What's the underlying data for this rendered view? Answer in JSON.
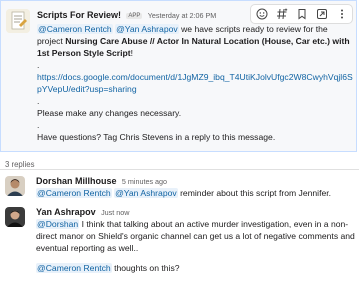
{
  "main_message": {
    "author": "Scripts For Review!",
    "badge": "APP",
    "timestamp": "Yesterday at 2:06 PM",
    "mention1": "@Cameron Rentch",
    "mention2": "@Yan Ashrapov",
    "text1": " we have scripts ready to review for the project ",
    "project": "Nursing Care Abuse // Actor In Natural Location (House, Car etc.) with 1st Person Style Script",
    "project_end": "!",
    "dot": ".",
    "link": "https://docs.google.com/document/d/1JgMZ9_ibq_T4UtiKJolvUfgc2W8CwyhVqjl6SpYVepU/edit?usp=sharing",
    "please": "Please make any changes necessary.",
    "questions": "Have questions? Tag Chris Stevens in a reply to this message.",
    "toolbar_icons": [
      "add-reaction-icon",
      "hashtag-icon",
      "bookmark-icon",
      "forward-icon",
      "more-icon"
    ]
  },
  "thread": {
    "count_label": "3 replies",
    "replies": [
      {
        "author": "Dorshan Millhouse",
        "time": "5 minutes ago",
        "mention1": "@Cameron Rentch",
        "mention2": "@Yan Ashrapov",
        "text": " reminder about this script from Jennifer."
      },
      {
        "author": "Yan Ashrapov",
        "time": "Just now",
        "mention": "@Dorshan",
        "text": " I think that talking about an active murder investigation, even in a non-direct manor on Shield's organic channel can get us a lot of negative comments and eventual reporting as well..",
        "mention2": "@Cameron Rentch",
        "text2": " thoughts on this?"
      }
    ]
  }
}
